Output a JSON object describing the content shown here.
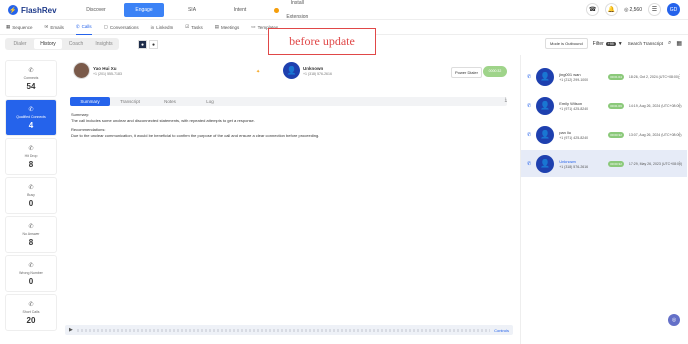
{
  "app": {
    "brand": "FlashRev"
  },
  "nav": {
    "items": [
      {
        "label": "Discover",
        "active": false
      },
      {
        "label": "Engage",
        "active": true
      },
      {
        "label": "SIA",
        "active": false
      },
      {
        "label": "Intent",
        "active": false
      }
    ],
    "extension": "Install Extension"
  },
  "top_right": {
    "credit": "2,560",
    "avatar": "GD"
  },
  "subnav": [
    {
      "label": "Sequence",
      "active": false,
      "icon": "grid-icon"
    },
    {
      "label": "Emails",
      "active": false,
      "icon": "mail-icon"
    },
    {
      "label": "Calls",
      "active": true,
      "icon": "phone-icon"
    },
    {
      "label": "Conversations",
      "active": false,
      "icon": "chat-icon"
    },
    {
      "label": "LinkedIn",
      "active": false,
      "icon": "linkedin-icon"
    },
    {
      "label": "Tasks",
      "active": false,
      "icon": "check-icon"
    },
    {
      "label": "Meetings",
      "active": false,
      "icon": "calendar-icon"
    },
    {
      "label": "Templates",
      "active": false,
      "icon": "file-icon"
    }
  ],
  "segmented": [
    {
      "label": "Dialer",
      "active": false
    },
    {
      "label": "History",
      "active": true
    },
    {
      "label": "Coach",
      "active": false
    },
    {
      "label": "Insights",
      "active": false
    }
  ],
  "annotation": "before update",
  "toolbar_right": {
    "mode": "Mode is Outbound",
    "filter": "Filter",
    "filter_badge": "+99",
    "search": "Search Transcript"
  },
  "stats": [
    {
      "label": "Connects",
      "value": "54",
      "active": false
    },
    {
      "label": "Qualified Connects",
      "value": "4",
      "active": true
    },
    {
      "label": "Hit Drop",
      "value": "8",
      "active": false
    },
    {
      "label": "Busy",
      "value": "0",
      "active": false
    },
    {
      "label": "No Answer",
      "value": "8",
      "active": false
    },
    {
      "label": "Wrong Number",
      "value": "0",
      "active": false
    },
    {
      "label": "Short Calls",
      "value": "20",
      "active": false
    }
  ],
  "call": {
    "caller": {
      "name": "Yao Hui Xu",
      "phone": "+1 (201) 555-7183"
    },
    "callee": {
      "name": "Unknown",
      "phone": "+1 (318) 576-2616"
    },
    "dialer": "Power Dialer",
    "status": "0000:32"
  },
  "detail_tabs": [
    {
      "label": "Summary",
      "active": true
    },
    {
      "label": "Transcript",
      "active": false
    },
    {
      "label": "Notes",
      "active": false
    },
    {
      "label": "Log",
      "active": false
    }
  ],
  "summary": {
    "h1": "Summary:",
    "t1": "The call includes some unclear and disconnected statements, with repeated attempts to get a response.",
    "h2": "Recommendations:",
    "t2": "Due to the unclear communication, it would be beneficial to confirm the purpose of the call and ensure a clear connection before proceeding."
  },
  "player": {
    "play": "▶",
    "label": "Controls"
  },
  "call_list": [
    {
      "name": "jing001 wan",
      "phone": "+1 (212) 299-1000",
      "tag": "00:01:04",
      "time": "18:26, Oct 2, 2024 (UTC+08:00)",
      "selected": false
    },
    {
      "name": "Emily Wilson",
      "phone": "+1 (971) 425-8240",
      "tag": "00:01:06",
      "time": "14:19, Aug 26, 2024 (UTC+08:00)",
      "selected": false
    },
    {
      "name": "pan liu",
      "phone": "+1 (971) 425-8240",
      "tag": "00:00:32",
      "time": "13:07, Aug 26, 2024 (UTC+08:00)",
      "selected": false
    },
    {
      "name": "Unknown",
      "phone": "+1 (318) 576-2616",
      "tag": "00:00:32",
      "time": "17:29, May 26, 2023 (UTC+08:00)",
      "selected": true
    }
  ]
}
